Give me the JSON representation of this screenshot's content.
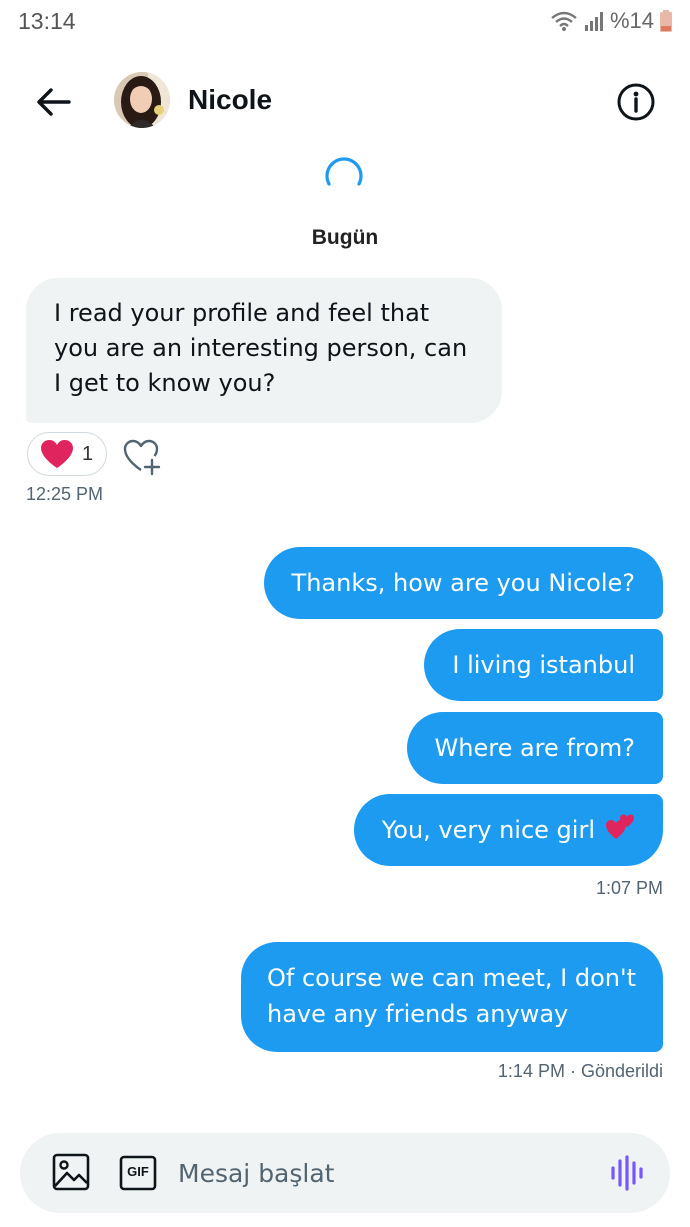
{
  "status_bar": {
    "time": "13:14",
    "battery": "%14"
  },
  "header": {
    "contact_name": "Nicole",
    "back_icon": "arrow-left-icon",
    "info_icon": "info-icon"
  },
  "conversation": {
    "date_separator": "Bugün",
    "received": {
      "text": "I read your profile and feel that you are an interesting person, can I get to know you?",
      "reaction_count": "1",
      "time": "12:25 PM"
    },
    "sent_group_1": [
      "Thanks, how are you Nicole?",
      "I living istanbul",
      "Where are from?",
      "You, very nice girl"
    ],
    "sent_group_1_time": "1:07 PM",
    "sent_last": "Of course we can meet, I don't have any friends anyway",
    "sent_last_status": "1:14 PM · Gönderildi"
  },
  "composer": {
    "placeholder": "Mesaj başlat",
    "gif_label": "GIF"
  },
  "colors": {
    "accent": "#1d9bf0",
    "bubble_in": "#eff3f4",
    "heart": "#e0245e",
    "voice": "#7856ff"
  }
}
